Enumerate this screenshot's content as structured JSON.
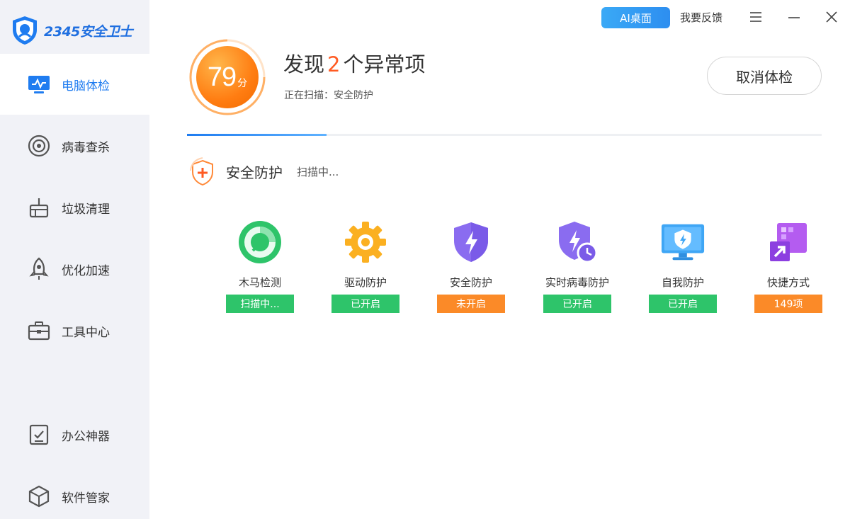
{
  "app": {
    "logo_text": "2345安全卫士"
  },
  "topbar": {
    "ai_label": "AI桌面",
    "feedback_label": "我要反馈"
  },
  "sidebar": {
    "items": [
      {
        "label": "电脑体检",
        "icon": "monitor-icon",
        "active": true
      },
      {
        "label": "病毒查杀",
        "icon": "target-icon"
      },
      {
        "label": "垃圾清理",
        "icon": "broom-icon"
      },
      {
        "label": "优化加速",
        "icon": "rocket-icon"
      },
      {
        "label": "工具中心",
        "icon": "toolbox-icon"
      },
      {
        "label": "办公神器",
        "icon": "checklist-icon"
      },
      {
        "label": "软件管家",
        "icon": "box-icon"
      }
    ]
  },
  "scan": {
    "score": "79",
    "score_unit": "分",
    "headline_prefix": "发现",
    "issue_count": "2",
    "headline_suffix": "个异常项",
    "status_line": "正在扫描：安全防护",
    "cancel_label": "取消体检",
    "progress": 0.22
  },
  "section": {
    "title": "安全防护",
    "status": "扫描中..."
  },
  "items": [
    {
      "label": "木马检测",
      "badge": "扫描中...",
      "badge_color": "#2ec46a",
      "icon": "trojan-scan-icon"
    },
    {
      "label": "驱动防护",
      "badge": "已开启",
      "badge_color": "#2ec46a",
      "icon": "gear-icon"
    },
    {
      "label": "安全防护",
      "badge": "未开启",
      "badge_color": "#fb8a28",
      "icon": "shield-bolt-icon"
    },
    {
      "label": "实时病毒防护",
      "badge": "已开启",
      "badge_color": "#2ec46a",
      "icon": "shield-clock-icon"
    },
    {
      "label": "自我防护",
      "badge": "已开启",
      "badge_color": "#2ec46a",
      "icon": "monitor-shield-icon"
    },
    {
      "label": "快捷方式",
      "badge": "149项",
      "badge_color": "#fb8a28",
      "icon": "shortcut-icon"
    }
  ],
  "colors": {
    "accent": "#1f7cf0",
    "score_orange": "#ff7d12",
    "issue_red": "#ff5b23",
    "ok_green": "#2ec46a",
    "warn_orange": "#fb8a28"
  }
}
